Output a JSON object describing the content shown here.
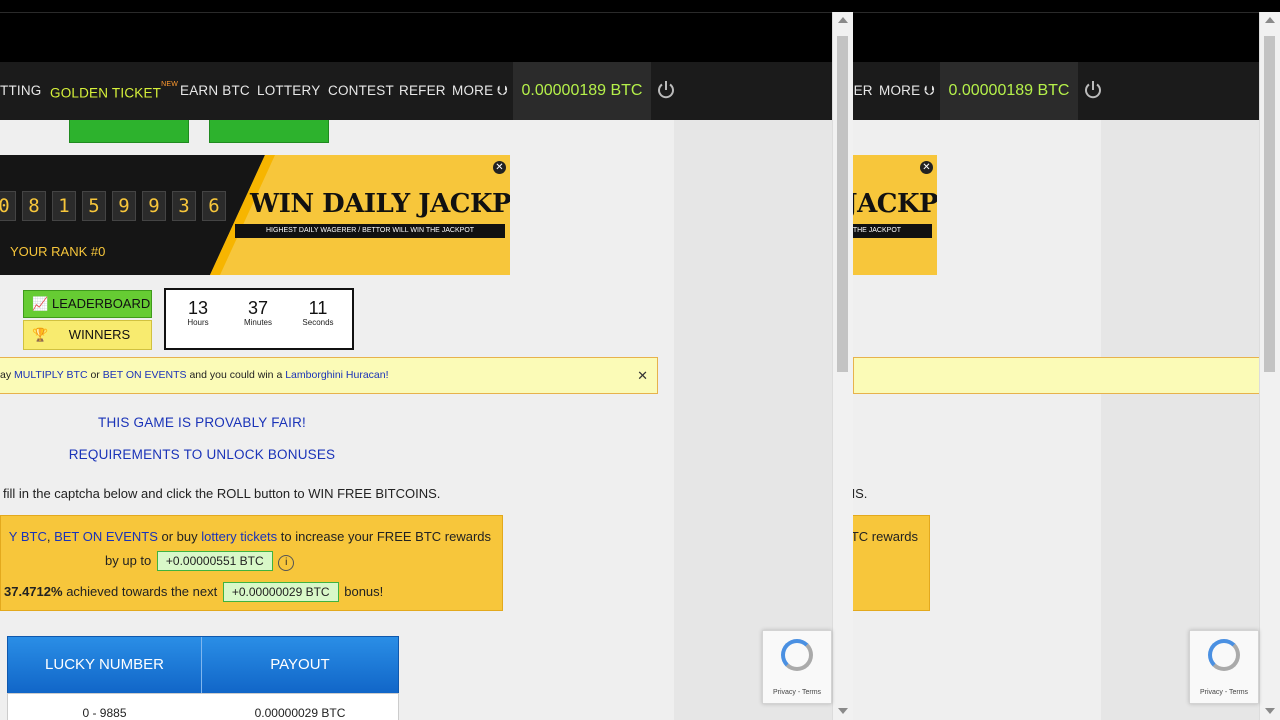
{
  "nav": {
    "items": [
      "TTING",
      "GOLDEN TICKET",
      "EARN BTC",
      "LOTTERY",
      "CONTEST",
      "REFER",
      "MORE"
    ],
    "new_badge": "NEW",
    "balance": "0.00000189 BTC"
  },
  "jackpot": {
    "digits": [
      "0",
      "8",
      "1",
      "5",
      "9",
      "9",
      "3",
      "6"
    ],
    "rank": "YOUR RANK #0",
    "title": "WIN DAILY JACKPOT",
    "subtitle": "HIGHEST DAILY WAGERER / BETTOR WILL WIN THE JACKPOT",
    "leaderboard_label": "LEADERBOARD",
    "winners_label": "WINNERS",
    "timer": {
      "hours": "13",
      "hours_label": "Hours",
      "minutes": "37",
      "minutes_label": "Minutes",
      "seconds": "11",
      "seconds_label": "Seconds"
    }
  },
  "notice": {
    "prefix": "ay",
    "link1": "MULTIPLY BTC",
    "middle1": "or",
    "link2": "BET ON EVENTS",
    "middle2": "and you could win a",
    "link3": "Lamborghini Huracan!"
  },
  "links": {
    "provably_fair": "THIS GAME IS PROVABLY FAIR!",
    "requirements": "REQUIREMENTS TO UNLOCK BONUSES"
  },
  "instruction": "fill in the captcha below and click the ROLL button to WIN FREE BITCOINS.",
  "promo": {
    "link1": "Y BTC",
    "sep": ",",
    "link2": "BET ON EVENTS",
    "text1": "or buy",
    "link3": "lottery tickets",
    "text2": "to increase your FREE BTC rewards",
    "by_up_to": "by up to",
    "pill1": "+0.00000551 BTC",
    "info": "i",
    "achieved": "37.4712%",
    "achieved_text": "achieved towards the next",
    "pill2": "+0.00000029 BTC",
    "bonus_text": "bonus!"
  },
  "table": {
    "headers": [
      "LUCKY NUMBER",
      "PAYOUT"
    ],
    "rows": [
      [
        "0 - 9885",
        "0.00000029 BTC"
      ]
    ]
  },
  "recaptcha": {
    "footer": "Privacy - Terms"
  },
  "colors": {
    "accent_gold": "#f7c63b",
    "balance_green": "#b5f04a",
    "link_blue": "#1a33b8"
  }
}
